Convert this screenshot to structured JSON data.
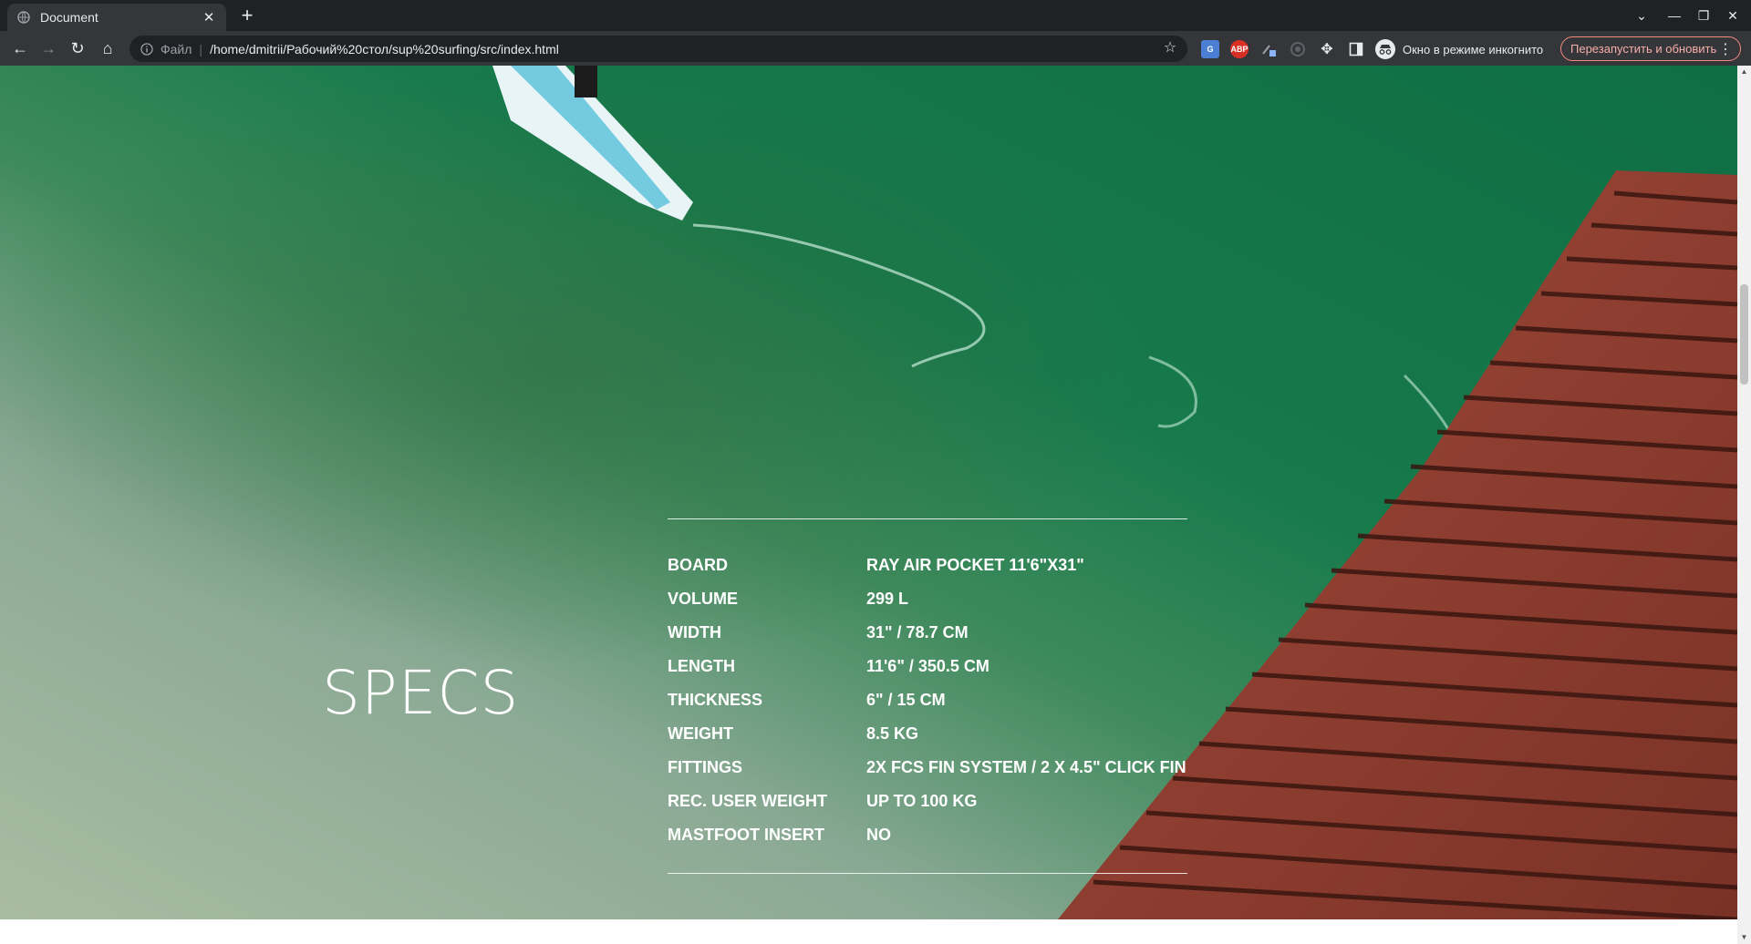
{
  "browser": {
    "tab_title": "Document",
    "address_scheme": "Файл",
    "address_url": "/home/dmitrii/Рабочий%20стол/sup%20surfing/src/index.html",
    "incognito_label": "Окно в режиме инкогнито",
    "relaunch_label": "Перезапустить и обновить",
    "extensions": [
      "translate-extension-icon",
      "adblock-plus-icon",
      "color-picker-extension-icon",
      "vpn-extension-icon"
    ]
  },
  "page": {
    "section_title": "SPECS",
    "specs": [
      {
        "label": "BOARD",
        "value": "RAY AIR POCKET 11'6\"X31\""
      },
      {
        "label": "VOLUME",
        "value": "299 L"
      },
      {
        "label": "WIDTH",
        "value": "31\" / 78.7 CM"
      },
      {
        "label": "LENGTH",
        "value": "11'6\" / 350.5 CM"
      },
      {
        "label": "THICKNESS",
        "value": "6\" / 15 CM"
      },
      {
        "label": "WEIGHT",
        "value": "8.5 KG"
      },
      {
        "label": "FITTINGS",
        "value": "2X FCS FIN SYSTEM / 2 X 4.5\" CLICK FIN"
      },
      {
        "label": "REC. USER WEIGHT",
        "value": "UP TO 100 KG"
      },
      {
        "label": "MASTFOOT INSERT",
        "value": "NO"
      }
    ]
  },
  "colors": {
    "water_shallow": "#9fb89c",
    "water_deep": "#137a4a",
    "dock": "#8a3b2c",
    "text": "#ffffff"
  }
}
